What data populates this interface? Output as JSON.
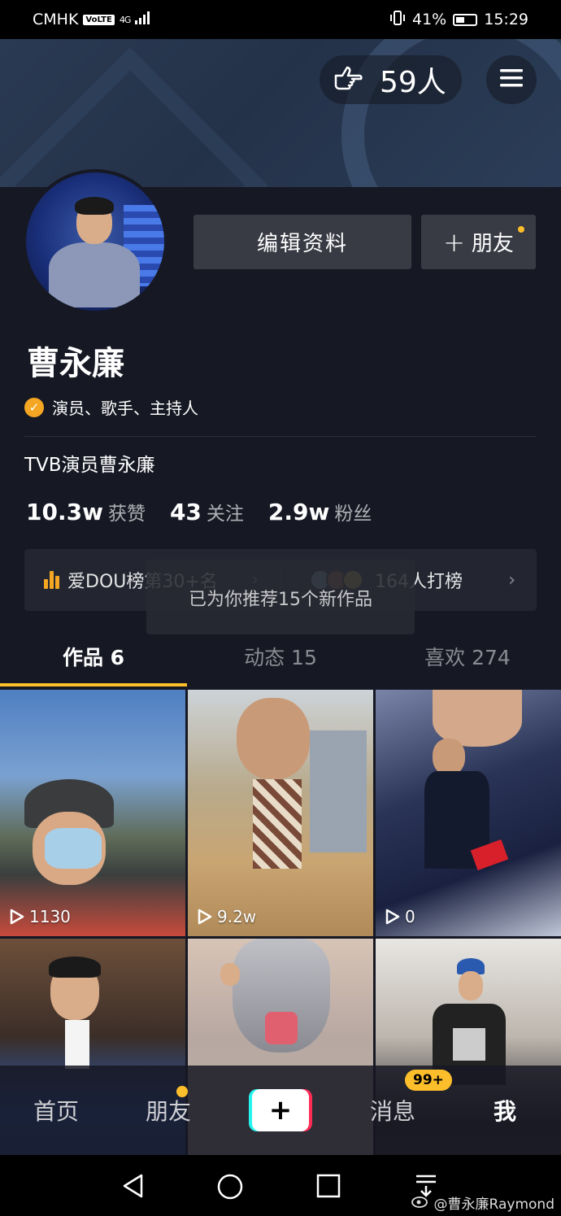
{
  "status_bar": {
    "carrier": "CMHK",
    "volte": "VoLTE",
    "network": "4G",
    "battery": "41%",
    "time": "15:29"
  },
  "header": {
    "visitors": "59人"
  },
  "profile": {
    "edit_label": "编辑资料",
    "friend_label": "朋友",
    "name": "曹永廉",
    "verification": "演员、歌手、主持人",
    "bio": "TVB演员曹永廉",
    "stats": [
      {
        "value": "10.3w",
        "label": "获赞"
      },
      {
        "value": "43",
        "label": "关注"
      },
      {
        "value": "2.9w",
        "label": "粉丝"
      }
    ]
  },
  "rank": {
    "left_text": "爱DOU榜第30+名",
    "right_text": "164人打榜"
  },
  "toast": "已为你推荐15个新作品",
  "tabs": [
    {
      "label": "作品 6"
    },
    {
      "label": "动态 15"
    },
    {
      "label": "喜欢 274"
    }
  ],
  "videos": [
    {
      "views": "1130"
    },
    {
      "views": "9.2w"
    },
    {
      "views": "0"
    },
    {
      "views": ""
    },
    {
      "views": ""
    },
    {
      "views": ""
    }
  ],
  "bottom_nav": {
    "home": "首页",
    "friends": "朋友",
    "messages": "消息",
    "messages_badge": "99+",
    "me": "我"
  },
  "watermark": "@曹永廉Raymond",
  "colors": {
    "accent": "#fdbe2b",
    "background": "#161823",
    "card": "#393b44",
    "verify": "#f5a623"
  }
}
